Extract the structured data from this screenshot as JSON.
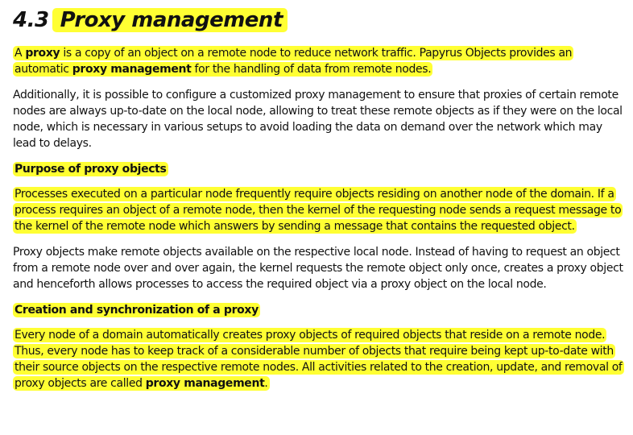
{
  "heading": {
    "number": "4.3",
    "title": "Proxy management"
  },
  "p1": {
    "t1": "A ",
    "b1": "proxy",
    "t2": " is a copy of an object on a remote node to reduce network traffic. Papyrus Objects provides an automatic ",
    "b2": "proxy management",
    "t3": " for the handling of data from remote nodes."
  },
  "p2": "Additionally, it is possible to configure a customized proxy management to ensure that proxies of certain remote nodes are always up-to-date on the local node, allowing to treat these remote objects as if they were on the local node, which is necessary in various setups to avoid loading the data on demand over the network which may lead to delays.",
  "section1": {
    "heading": "Purpose of proxy objects",
    "p1": "Processes executed on a particular node frequently require objects residing on another node of the domain. If a process requires an object of a remote node, then the kernel of the requesting node sends a request message to the kernel of the remote node which answers by sending a message that contains the requested object.",
    "p2": "Proxy objects make remote objects available on the respective local node. Instead of having to request an object from a remote node over and over again, the kernel requests the remote object only once, creates a proxy object and henceforth allows processes to access the required object via a proxy object on the local node."
  },
  "section2": {
    "heading": "Creation and synchronization of a proxy",
    "p1_text": "Every node of a domain automatically creates proxy objects of required objects that reside on a remote node. Thus, every node has to keep track of a considerable number of objects that require being kept up-to-date with their source objects on the respective remote nodes. All activities related to the creation, update, and removal of proxy objects are called ",
    "p1_bold": "proxy management",
    "p1_end": "."
  },
  "colors": {
    "highlight": "#ffff33",
    "text": "#111111"
  }
}
